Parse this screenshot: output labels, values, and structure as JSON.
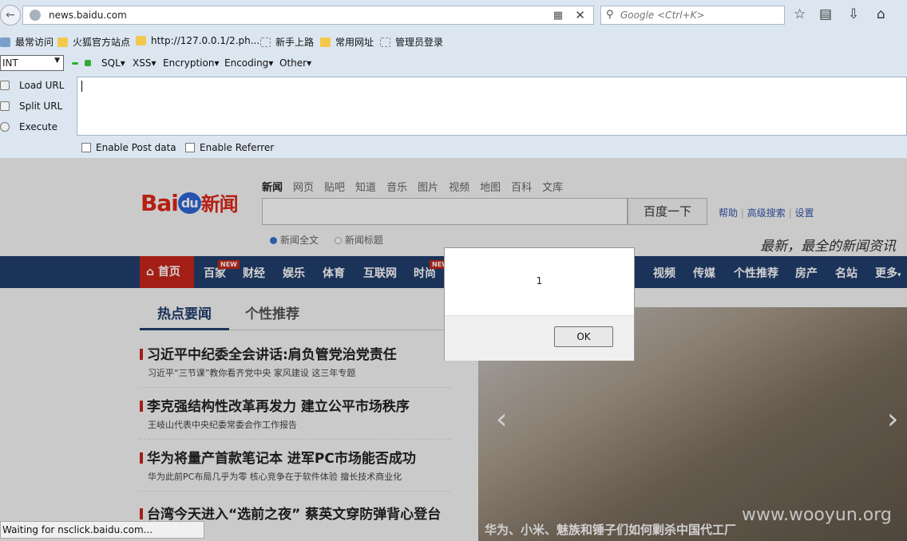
{
  "nav": {
    "url": "news.baidu.com",
    "search_placeholder": "Google <Ctrl+K>"
  },
  "bookmarks": [
    {
      "label": "最常访问"
    },
    {
      "label": "火狐官方站点"
    },
    {
      "label": "http://127.0.0.1/2.ph..."
    },
    {
      "label": "新手上路"
    },
    {
      "label": "常用网址"
    },
    {
      "label": "管理员登录"
    }
  ],
  "hackbar": {
    "select_value": "INT",
    "menus": [
      "SQL",
      "XSS",
      "Encryption",
      "Encoding",
      "Other"
    ],
    "actions": [
      "Load URL",
      "Split URL",
      "Execute"
    ],
    "checkboxes": [
      "Enable Post data",
      "Enable Referrer"
    ]
  },
  "baidu": {
    "logo_text": "Bai",
    "logo_du": "du",
    "logo_news": "新闻",
    "tabs": [
      "新闻",
      "网页",
      "贴吧",
      "知道",
      "音乐",
      "图片",
      "视频",
      "地图",
      "百科",
      "文库"
    ],
    "search_button": "百度一下",
    "links": [
      "帮助",
      "高级搜索",
      "设置"
    ],
    "radios": [
      "新闻全文",
      "新闻标题"
    ],
    "slogan": "最新，最全的新闻资讯",
    "nav_home": "首页",
    "nav_items": [
      "百家",
      "财经",
      "娱乐",
      "体育",
      "互联网",
      "时尚",
      "视频",
      "传媒",
      "个性推荐",
      "房产",
      "名站",
      "更多"
    ],
    "nav_new_badge": "NEW",
    "hot_tab": "热点要闻",
    "personal_tab": "个性推荐",
    "news": [
      {
        "title": "习近平中纪委全会讲话:肩负管党治党责任",
        "sub": "习近平“三节课”教你看齐党中央   家风建设   这三年专题"
      },
      {
        "title": "李克强结构性改革再发力 建立公平市场秩序",
        "sub": "王岐山代表中央纪委常委会作工作报告"
      },
      {
        "title": "华为将量产首款笔记本 进军PC市场能否成功",
        "sub": "华为此前PC布局几乎为零   核心竞争在于软件体验   擅长技术商业化"
      },
      {
        "title": "台湾今天进入“选前之夜” 蔡英文穿防弹背心登台",
        "sub": ""
      }
    ],
    "photo_caption": "华为、小米、魅族和锤子们如何剿杀中国代工厂",
    "watermark": "www.wooyun.org"
  },
  "alert": {
    "message": "1",
    "ok_label": "OK"
  },
  "status_text": "Waiting for nsclick.baidu.com..."
}
